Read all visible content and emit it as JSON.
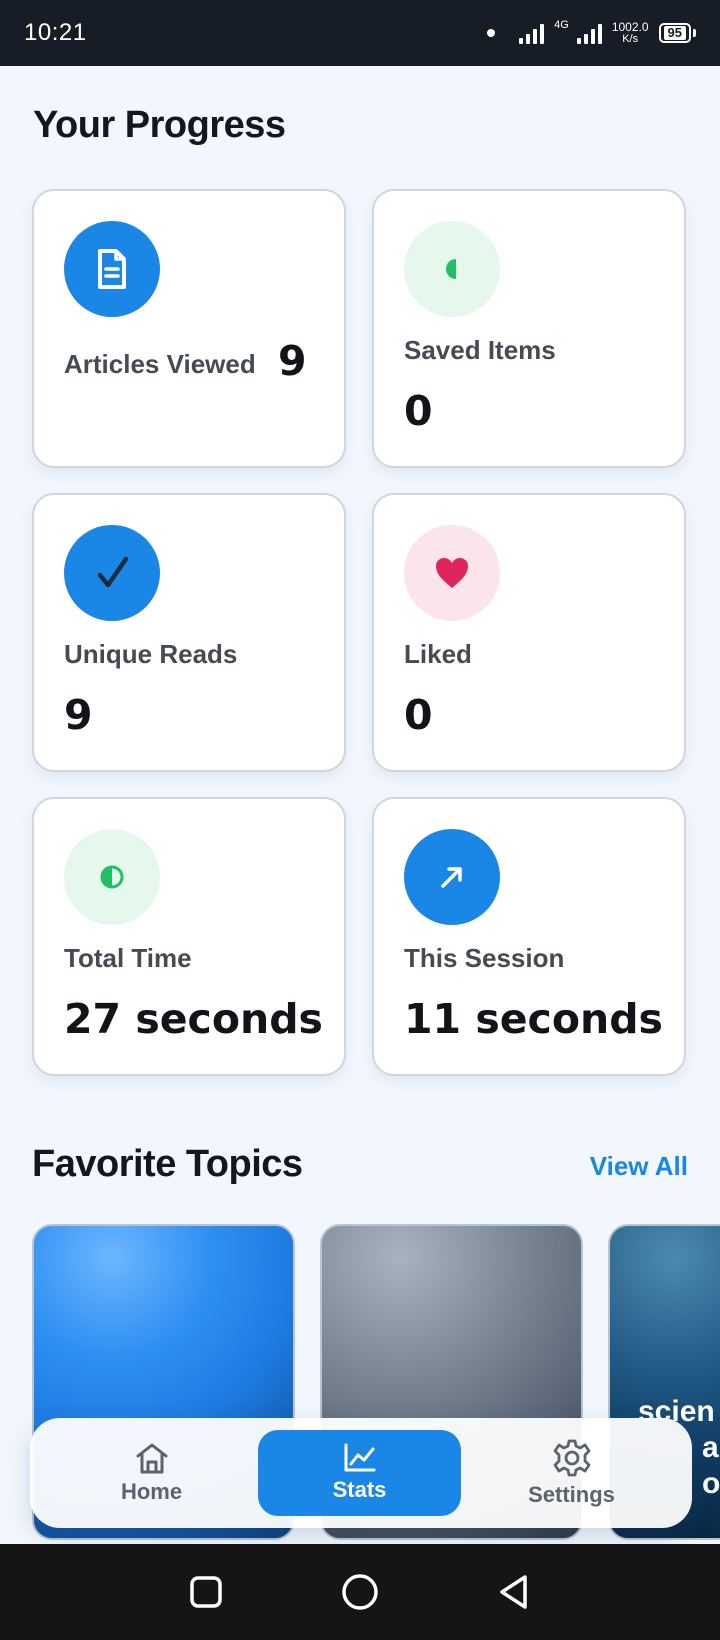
{
  "status_bar": {
    "time": "10:21",
    "network_type": "4G",
    "net_speed_value": "1002.0",
    "net_speed_unit": "K/s",
    "battery": "95"
  },
  "page_title": "Your Progress",
  "stats": {
    "articles_viewed": {
      "label": "Articles Viewed",
      "value": "9",
      "icon": "document-icon",
      "color": "#1a86e6"
    },
    "saved_items": {
      "label": "Saved Items",
      "value": "0",
      "icon": "bookmark-icon",
      "color": "#22c064"
    },
    "unique_reads": {
      "label": "Unique Reads",
      "value": "9",
      "icon": "checkmark-icon",
      "color": "#1a86e6"
    },
    "liked": {
      "label": "Liked",
      "value": "0",
      "icon": "heart-icon",
      "color": "#e0245e"
    },
    "total_time": {
      "label": "Total Time",
      "value": "27 seconds",
      "icon": "clock-icon",
      "color": "#22c064"
    },
    "this_session": {
      "label": "This Session",
      "value": "11 seconds",
      "icon": "trend-arrow-icon",
      "color": "#1a86e6"
    }
  },
  "favorite_topics": {
    "title": "Favorite Topics",
    "view_all_label": "View All",
    "items": [
      {
        "text_line1": "",
        "text_line2": ""
      },
      {
        "text_line1": "",
        "text_line2": ""
      },
      {
        "text_line1": "scien",
        "text_line2": "an",
        "text_line3": "oin"
      }
    ]
  },
  "bottom_nav": {
    "home_label": "Home",
    "stats_label": "Stats",
    "settings_label": "Settings",
    "active": "Stats"
  }
}
